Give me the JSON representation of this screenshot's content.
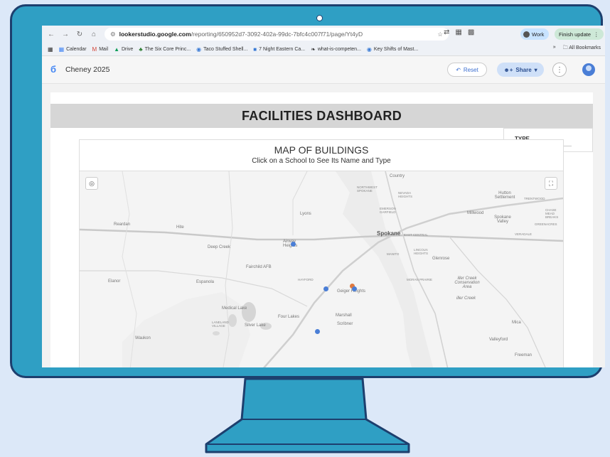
{
  "browser": {
    "url_host": "lookerstudio.google.com",
    "url_path": "/reporting/650952d7-3092-402a-99dc-7bfc4c007f71/page/Yt4yD",
    "profile_label": "Work",
    "finish_update_label": "Finish update",
    "bookmarks": [
      "Calendar",
      "Mail",
      "Drive",
      "The Six Core Princ...",
      "Taco Stuffed Shell...",
      "7 Night Eastern Ca...",
      "what-is-competen...",
      "Key Shifts of Mast..."
    ],
    "all_bookmarks_label": "All Bookmarks",
    "more_label": "»"
  },
  "looker": {
    "report_title": "Cheney 2025",
    "reset_label": "Reset",
    "share_label": "Share"
  },
  "report": {
    "banner_title": "FACILITIES DASHBOARD",
    "type_filter_label": "TYPE",
    "map_title": "MAP OF BUILDINGS",
    "map_subtitle": "Click on a School to See Its Name and Type",
    "map_labels": {
      "spokane": "Spokane",
      "east_central": "EAST CENTRAL",
      "lyons": "Lyons",
      "deep_creek": "Deep Creek",
      "airway_heights": "Airway Heights",
      "fairchild": "Fairchild AFB",
      "espanola": "Espanola",
      "reardan": "Reardan",
      "elanor": "Elanor",
      "hite": "Hite",
      "medical_lake": "Medical Lake",
      "four_lakes": "Four Lakes",
      "silver_lake": "Silver Lake",
      "laneland": "LANELAND VILLAGE",
      "waukon": "Waukon",
      "geiger": "Geiger Heights",
      "marshall": "Marshall",
      "scribner": "Scribner",
      "hayford": "HAYFORD",
      "manito": "MANITO",
      "lincoln": "LINCOLN HEIGHTS",
      "glenrose": "Glenrose",
      "moran": "MORAN PRAIRIE",
      "conservation": "iller Creek Conservation Area",
      "iller_creek": "iller Creek",
      "mica": "Mica",
      "valleyford": "Valleyford",
      "freeman": "Freeman",
      "millwood": "Millwood",
      "spokane_valley": "Spokane Valley",
      "hutton": "Hutton Settlement",
      "trentwood": "TRENTWOOD",
      "greenacres": "GREENACRES",
      "veradale": "VERADALE",
      "northwest": "NORTHWEST SPOKANE",
      "nevada": "NEVADA HEIGHTS",
      "emerson": "EMERSON GARFIELD",
      "country": "Country",
      "chase": "CHASE MEAD BREAKS"
    }
  }
}
